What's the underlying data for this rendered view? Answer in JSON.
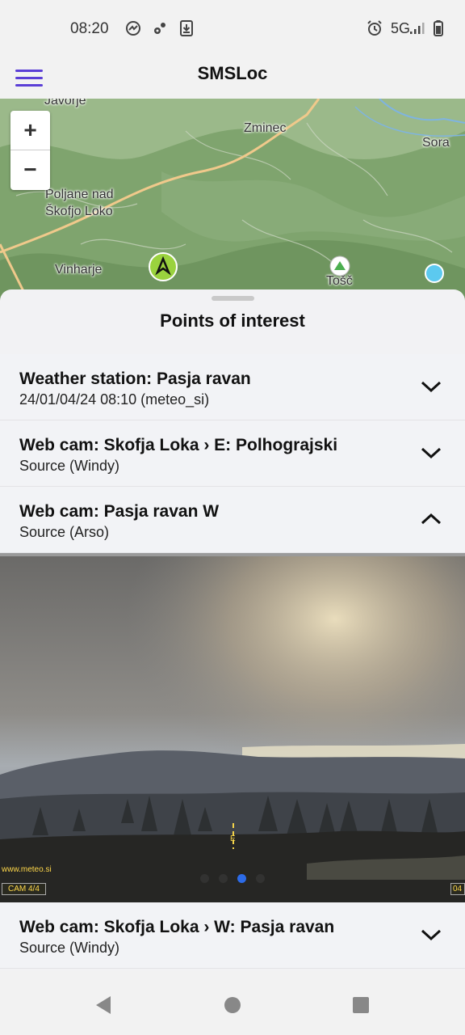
{
  "status_bar": {
    "time": "08:20",
    "network": "5G",
    "icons": [
      "messenger-icon",
      "settings-cog-icon",
      "download-icon",
      "alarm-icon",
      "signal-icon",
      "battery-icon"
    ]
  },
  "app_bar": {
    "title": "SMSLoc"
  },
  "map": {
    "zoom_in": "+",
    "zoom_out": "−",
    "labels": {
      "javorje": "Javorje",
      "zminec": "Zminec",
      "sora": "Sora",
      "poljane": "Poljane nad\nŠkofjo Loko",
      "vinharje": "Vinharje",
      "tosc": "Tošč"
    }
  },
  "sheet": {
    "title": "Points of interest",
    "items": [
      {
        "title": "Weather station: Pasja ravan",
        "subtitle": "24/01/04/24 08:10 (meteo_si)",
        "expanded": false
      },
      {
        "title": "Web cam: Skofja Loka › E: Polhograjski",
        "subtitle": "Source (Windy)",
        "expanded": false
      },
      {
        "title": "Web cam: Pasja ravan W",
        "subtitle": "Source (Arso)",
        "expanded": true
      },
      {
        "title": "Web cam: Skofja Loka › W: Pasja ravan",
        "subtitle": "Source (Windy)",
        "expanded": false
      }
    ],
    "webcam": {
      "watermark": "www.meteo.si",
      "cam_label": "CAM 4/4",
      "cam_label_right": "04",
      "direction_mark": "E",
      "pager_count": 4,
      "pager_active": 3
    }
  },
  "colors": {
    "accent": "#5b3fd6",
    "pager_active": "#2c6be8"
  }
}
